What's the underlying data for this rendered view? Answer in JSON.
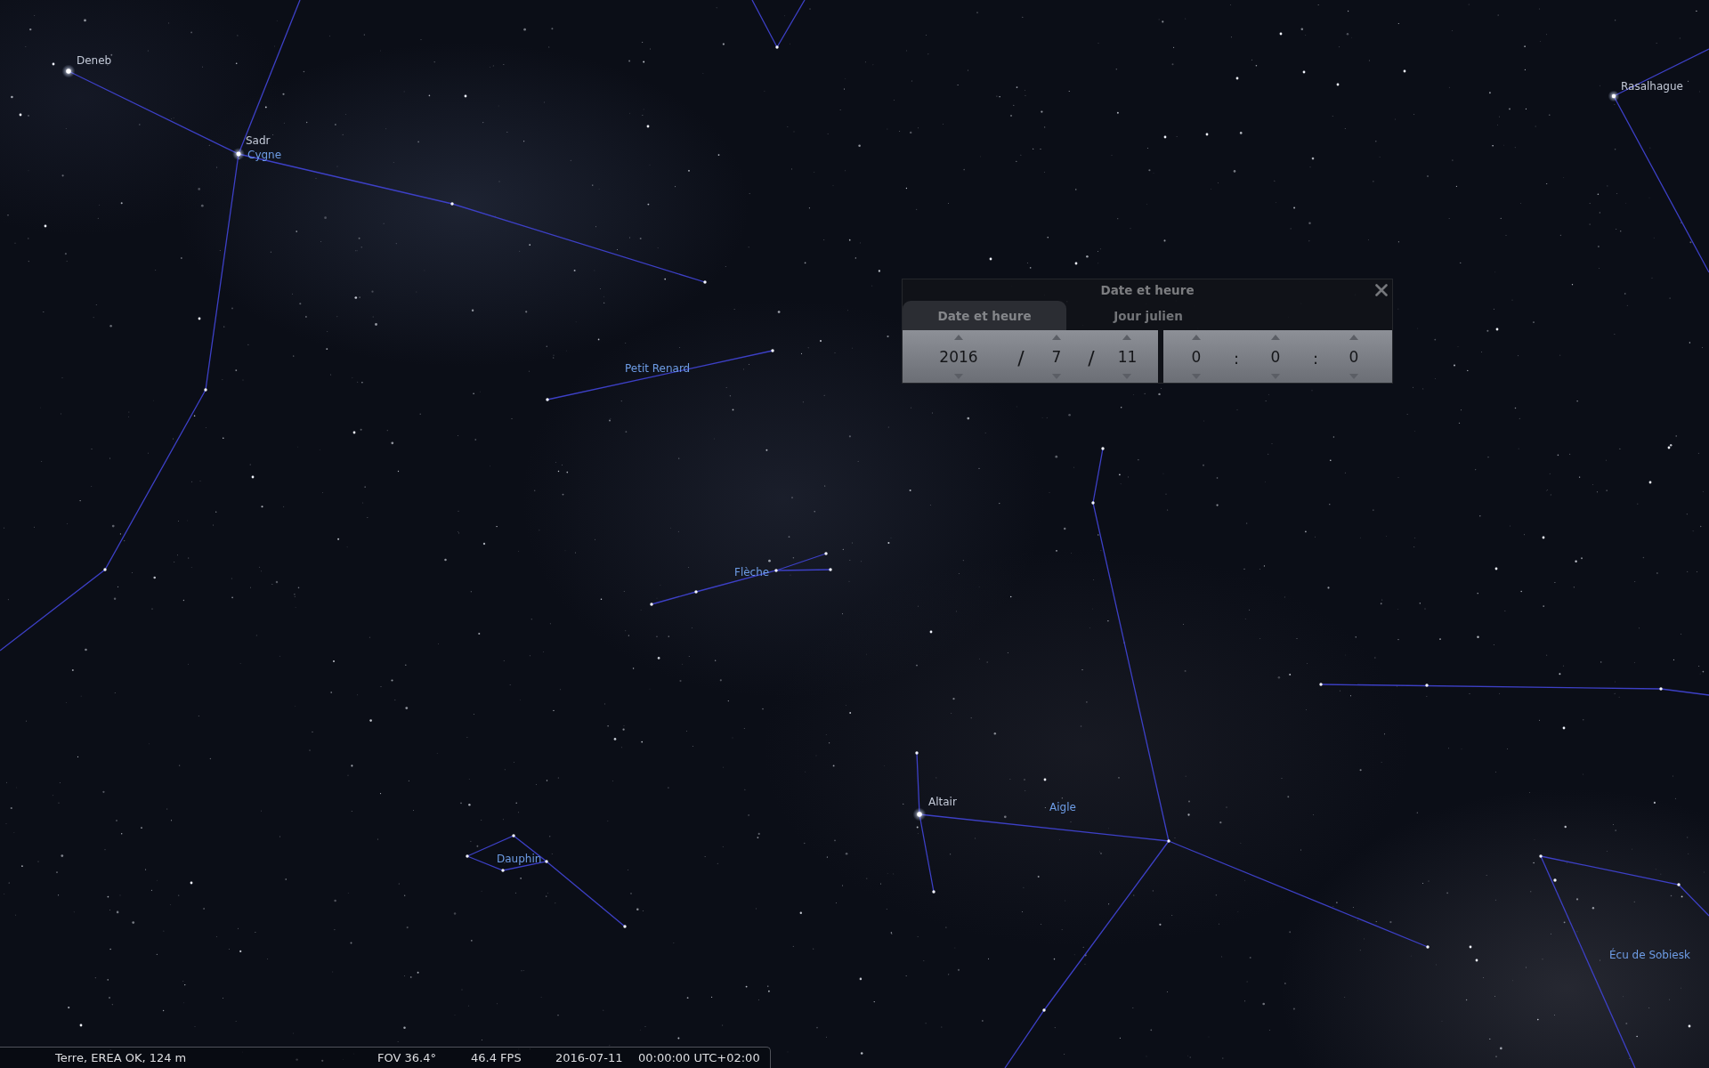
{
  "sky": {
    "labels": [
      {
        "kind": "star",
        "text": "Deneb"
      },
      {
        "kind": "star",
        "text": "Sadr"
      },
      {
        "kind": "constellation",
        "text": "Cygne"
      },
      {
        "kind": "star",
        "text": "Rasalhague"
      },
      {
        "kind": "constellation",
        "text": "Petit Renard"
      },
      {
        "kind": "constellation",
        "text": "Flèche"
      },
      {
        "kind": "star",
        "text": "Altair"
      },
      {
        "kind": "constellation",
        "text": "Aigle"
      },
      {
        "kind": "constellation",
        "text": "Dauphin"
      },
      {
        "kind": "constellation",
        "text": "Écu de Sobiesk"
      }
    ]
  },
  "dialog": {
    "title": "Date et heure",
    "tabs": [
      {
        "label": "Date et heure",
        "selected": true
      },
      {
        "label": "Jour julien",
        "selected": false
      }
    ],
    "date": {
      "fields": [
        "2016",
        "7",
        "11"
      ],
      "separators": [
        "/",
        "/"
      ]
    },
    "time": {
      "fields": [
        "0",
        "0",
        "0"
      ],
      "separators": [
        ":",
        ":"
      ]
    }
  },
  "status_bar": {
    "location": "Terre, EREA OK, 124 m",
    "fov": "FOV 36.4°",
    "fps": "46.4 FPS",
    "date": "2016-07-11",
    "time": "00:00:00 UTC+02:00"
  }
}
